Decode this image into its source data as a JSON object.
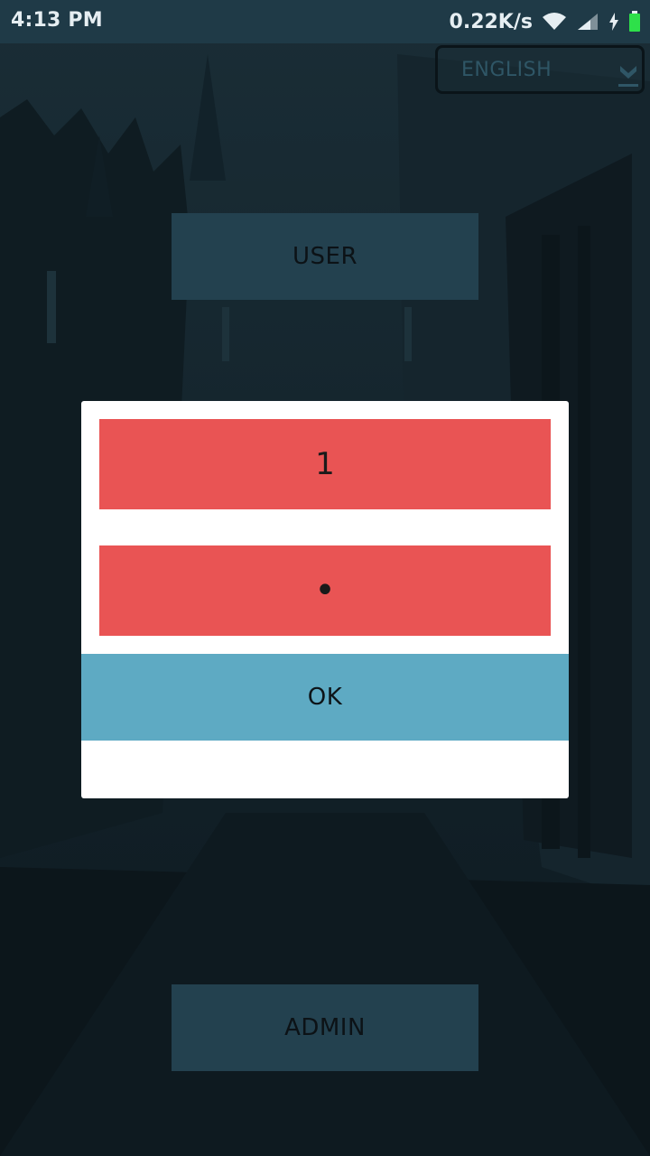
{
  "status_bar": {
    "time": "4:13 PM",
    "network_speed": "0.22K/s",
    "icons": [
      "wifi-icon",
      "signal-icon",
      "charging-icon",
      "battery-icon"
    ]
  },
  "language_select": {
    "selected": "ENGLISH",
    "icon": "chevron-down-icon"
  },
  "buttons": {
    "user_label": "USER",
    "admin_label": "ADMIN"
  },
  "login_dialog": {
    "username_value": "1",
    "password_value": "•",
    "ok_label": "OK"
  },
  "colors": {
    "status_bar": "#1f3a47",
    "role_button": "#23414f",
    "field_background": "#e95454",
    "ok_button": "#5eaac3",
    "dialog_background": "#ffffff"
  }
}
